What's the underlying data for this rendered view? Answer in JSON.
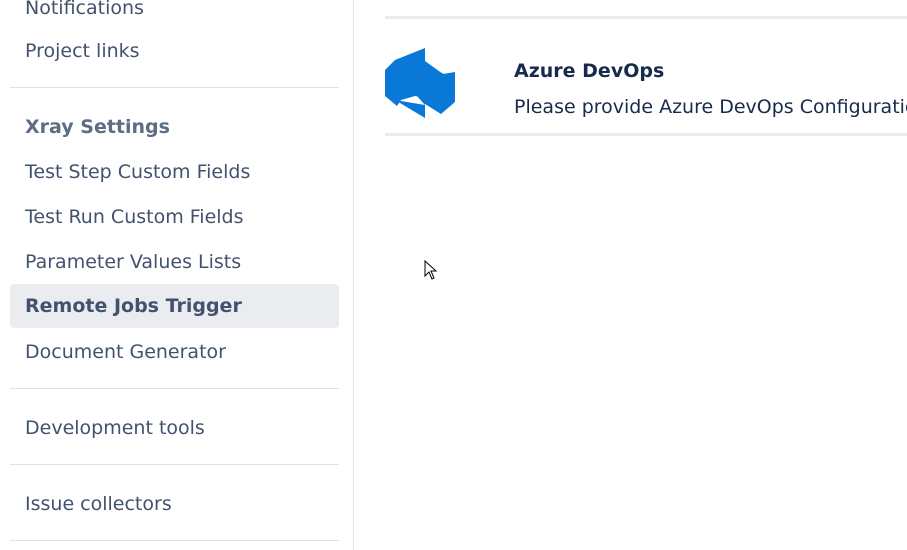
{
  "sidebar": {
    "items_top": [
      {
        "label": "Notifications"
      },
      {
        "label": "Project links"
      }
    ],
    "xray_heading": "Xray Settings",
    "xray_items": [
      {
        "label": "Test Step Custom Fields"
      },
      {
        "label": "Test Run Custom Fields"
      },
      {
        "label": "Parameter Values Lists"
      },
      {
        "label": "Remote Jobs Trigger",
        "active": true
      },
      {
        "label": "Document Generator"
      }
    ],
    "development_tools": "Development tools",
    "issue_collectors": "Issue collectors"
  },
  "main": {
    "integrations": [
      {
        "title": "Azure DevOps",
        "description": "Please provide Azure DevOps Configuration",
        "icon": "azure-devops-icon",
        "icon_color": "#0078d4"
      }
    ]
  }
}
